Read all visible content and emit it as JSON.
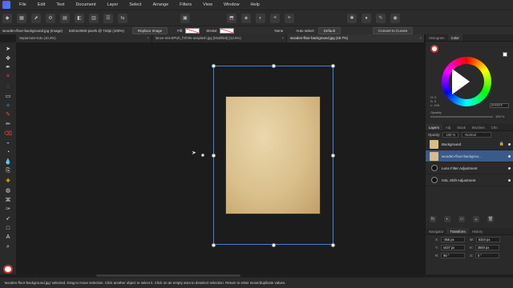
{
  "menu": [
    "File",
    "Edit",
    "Text",
    "Document",
    "Layer",
    "Select",
    "Arrange",
    "Filters",
    "View",
    "Window",
    "Help"
  ],
  "context": {
    "doc_info": "wooden-floor-background.jpg (Image)",
    "pixels": "5324x3550 pixels @ 72dpi (100%)",
    "replace_image": "Replace Image",
    "fill": "Fill:",
    "stroke": "Stroke:",
    "none": "None",
    "auto_select": "Auto select:",
    "auto_select_value": "Default",
    "convert": "Convert to Curves"
  },
  "tabs": [
    {
      "label": "Sepia-tone-tuto (10.4%)",
      "active": false
    },
    {
      "label": "lance-reis-8PUh_fVfz9s-unsplash.jpg [Modified] (12.6%)",
      "active": false
    },
    {
      "label": "wooden-floor-background.jpg (19.7%)",
      "active": true
    }
  ],
  "panels": {
    "top_tabs": [
      "Histogram",
      "Color"
    ],
    "hsl": [
      "H: 0",
      "S: 0",
      "L: 100"
    ],
    "hex": "FFFFFF",
    "opacity_label": "Opacity",
    "opacity_pct": "100 %",
    "layer_tabs": [
      "Layers",
      "Adj",
      "Stock",
      "Brushes",
      "Chn"
    ],
    "layer_opacity_label": "Opacity:",
    "layer_opacity": "100 %",
    "blend_mode": "Normal",
    "layers": [
      {
        "name": "Background",
        "type": "image",
        "selected": false
      },
      {
        "name": "wooden-floor-backgrou...",
        "type": "image",
        "selected": true
      },
      {
        "name": "Lens Filter Adjustment",
        "type": "adjustment",
        "selected": false
      },
      {
        "name": "HSL Shift Adjustment",
        "type": "adjustment",
        "selected": false
      }
    ],
    "bottom_tabs": [
      "Navigator",
      "Transform",
      "History"
    ],
    "transform": {
      "x": "-355 px",
      "y": "4437 px",
      "w": "5324 px",
      "h": "3550 px",
      "r": "90 °",
      "s": "0 °"
    }
  },
  "status": "'wooden-floor-background.jpg' selected. Drag to move selection. Click another object to select it. Click on an empty area to deselect selection. Return to enter move/duplicate values."
}
